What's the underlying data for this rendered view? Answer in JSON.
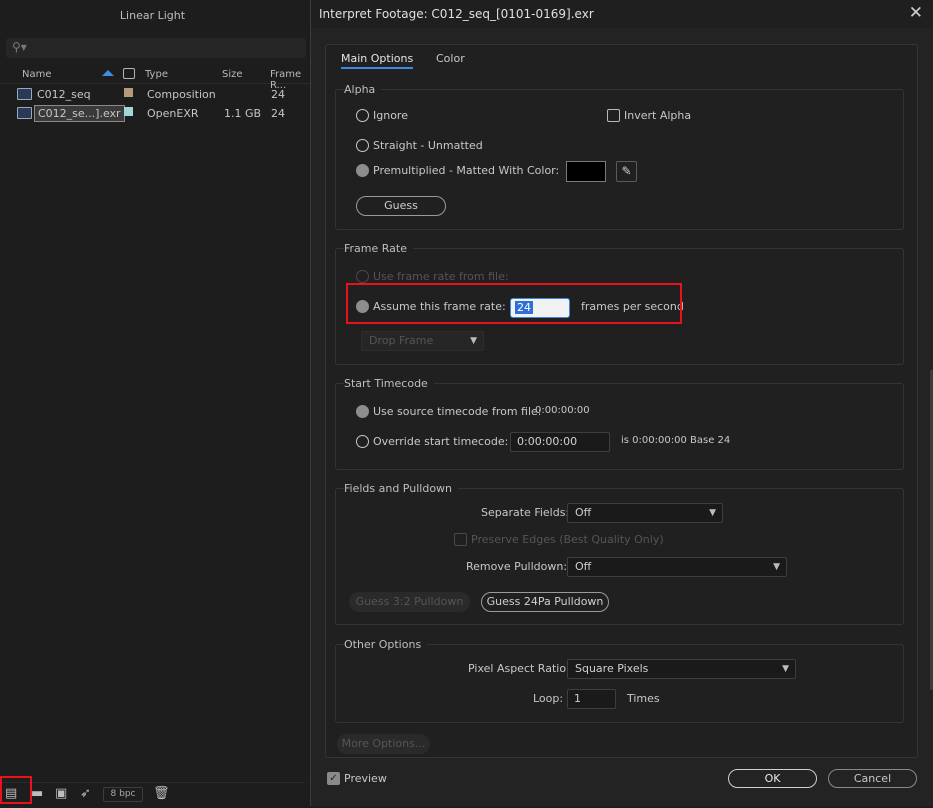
{
  "project": {
    "title": "Linear Light",
    "search_icon": "search-icon",
    "columns": {
      "name": "Name",
      "type": "Type",
      "size": "Size",
      "frame_rate": "Frame R..."
    },
    "rows": [
      {
        "name": "C012_seq",
        "type": "Composition",
        "size": "",
        "frame_rate": "24",
        "swatch": "#b39a7a",
        "selected": false
      },
      {
        "name": "C012_se...].exr",
        "type": "OpenEXR",
        "size": "1.1 GB",
        "frame_rate": "24",
        "swatch": "#a3d6d6",
        "selected": true
      }
    ],
    "bpc": "8 bpc"
  },
  "dialog": {
    "title": "Interpret Footage: C012_seq_[0101-0169].exr",
    "tabs": [
      "Main Options",
      "Color"
    ],
    "alpha": {
      "label": "Alpha",
      "ignore": "Ignore",
      "invert_alpha": "Invert Alpha",
      "straight": "Straight - Unmatted",
      "premultiplied": "Premultiplied - Matted With Color:",
      "matte_color": "#000000",
      "guess": "Guess"
    },
    "frame_rate": {
      "label": "Frame Rate",
      "use_file": "Use frame rate from file:",
      "assume": "Assume this frame rate:",
      "value": "24",
      "fps": "frames per second",
      "drop_frame": "Drop Frame"
    },
    "start_timecode": {
      "label": "Start Timecode",
      "use_source": "Use source timecode from file:",
      "source_value": "0:00:00:00",
      "override": "Override start timecode:",
      "override_value": "0:00:00:00",
      "info": "is 0:00:00:00  Base 24"
    },
    "fields": {
      "label": "Fields and Pulldown",
      "separate_fields_label": "Separate Fields:",
      "separate_fields_value": "Off",
      "preserve_edges": "Preserve Edges (Best Quality Only)",
      "remove_pulldown_label": "Remove Pulldown:",
      "remove_pulldown_value": "Off",
      "guess_32": "Guess 3:2 Pulldown",
      "guess_24pa": "Guess 24Pa Pulldown"
    },
    "other": {
      "label": "Other Options",
      "par_label": "Pixel Aspect Ratio:",
      "par_value": "Square Pixels",
      "loop_label": "Loop:",
      "loop_value": "1",
      "times": "Times"
    },
    "more_options": "More Options...",
    "preview": "Preview",
    "ok": "OK",
    "cancel": "Cancel"
  },
  "highlight_color": "#e8121c",
  "accent_color": "#3f87e4"
}
